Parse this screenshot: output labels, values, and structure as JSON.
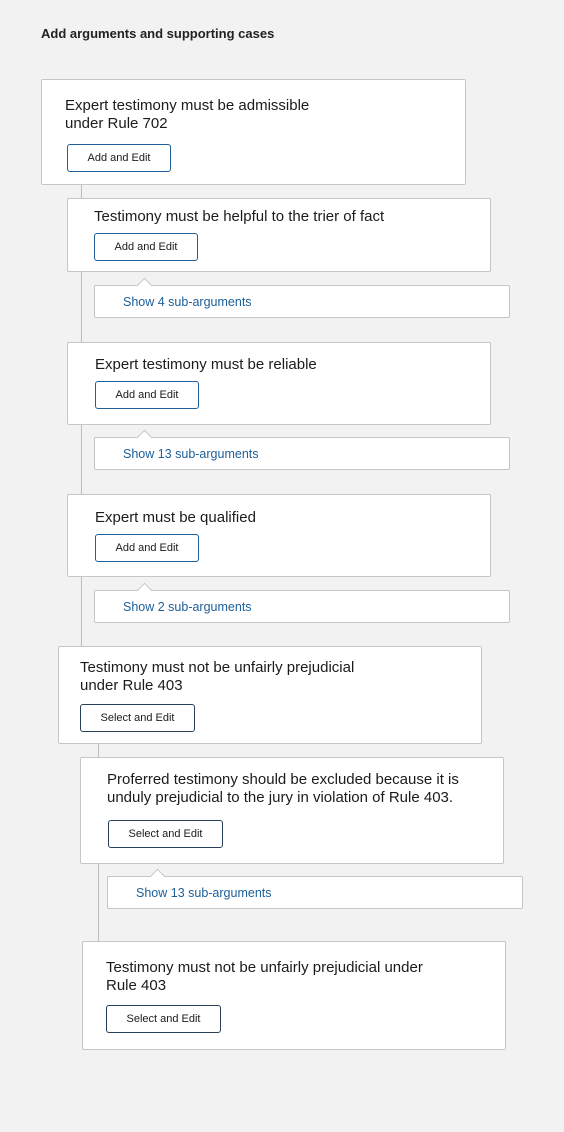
{
  "heading": "Add arguments and supporting cases",
  "arguments": [
    {
      "title": "Expert testimony must be admissible\nunder Rule 702",
      "button": "Add and Edit"
    },
    {
      "title": "Testimony must be helpful to the trier of fact",
      "button": "Add and Edit",
      "sub": "Show 4 sub-arguments"
    },
    {
      "title": "Expert testimony must be reliable",
      "button": "Add and Edit",
      "sub": "Show 13 sub-arguments"
    },
    {
      "title": "Expert must be qualified",
      "button": "Add and Edit",
      "sub": "Show 2 sub-arguments"
    },
    {
      "title": "Testimony must not be unfairly prejudicial\nunder Rule 403",
      "button": "Select and Edit"
    },
    {
      "title": "Proferred testimony should be excluded because it is\nunduly prejudicial to the jury in violation of Rule 403.",
      "button": "Select and Edit",
      "sub": "Show 13 sub-arguments"
    },
    {
      "title": "Testimony must not be unfairly prejudicial under\nRule 403",
      "button": "Select and Edit"
    }
  ]
}
